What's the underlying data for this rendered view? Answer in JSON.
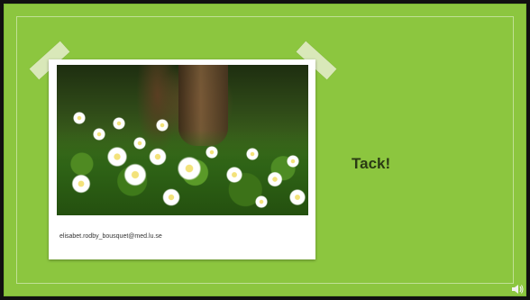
{
  "slide": {
    "background_color": "#8cc63f",
    "title": "Tack!",
    "photo_caption": "elisabet.rodby_bousquet@med.lu.se"
  },
  "controls": {
    "audio_icon": "speaker-icon"
  }
}
